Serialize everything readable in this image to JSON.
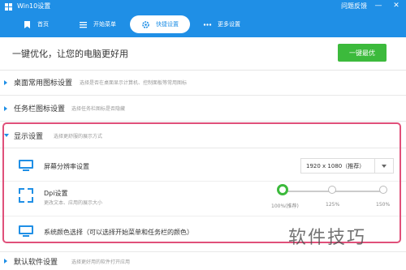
{
  "app": {
    "title": "Win10设置",
    "help": "问题反馈"
  },
  "window_controls": [
    "—",
    "✕"
  ],
  "nav": {
    "items": [
      {
        "label": "首页",
        "icon": "bookmark-icon"
      },
      {
        "label": "开始菜单",
        "icon": "menu-icon"
      },
      {
        "label": "快捷设置",
        "icon": "gear-icon",
        "active": true
      },
      {
        "label": "更多设置",
        "icon": "more-icon"
      }
    ]
  },
  "hero": {
    "text": "一键优化，让您的电脑更好用",
    "button": "一键最优"
  },
  "sections": [
    {
      "title": "桌面常用图标设置",
      "desc": "选择是否在桌面显示计算机、控制面板等常用图标",
      "expanded": false
    },
    {
      "title": "任务栏图标设置",
      "desc": "选择任务栏图标是否隐藏",
      "expanded": false
    },
    {
      "title": "显示设置",
      "desc": "选择更舒服的展示方式",
      "expanded": true
    },
    {
      "title": "默认软件设置",
      "desc": "选择更好用的软件打开应用",
      "expanded": false
    }
  ],
  "display": {
    "resolution": {
      "label": "屏幕分辨率设置",
      "value": "1920 x 1080（推荐）"
    },
    "dpi": {
      "label": "Dpi设置",
      "sub": "更改文本、应用的展示大小",
      "options": [
        "100%(推荐)",
        "125%",
        "150%"
      ],
      "selected_index": 0
    },
    "color": {
      "label": "系统颜色选择（可以选择开始菜单和任务栏的颜色）"
    }
  },
  "watermark": "软件技巧",
  "colors": {
    "accent": "#1f8fe6",
    "green": "#3cba3c",
    "highlight": "#e0507a"
  }
}
